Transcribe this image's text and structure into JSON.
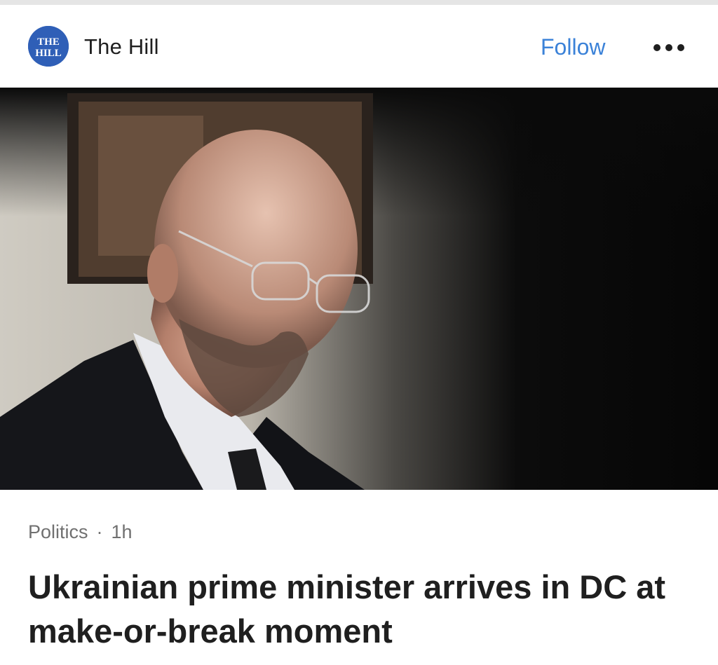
{
  "header": {
    "logo_text": "THE HILL",
    "publisher": "The Hill",
    "follow_label": "Follow",
    "more_icon": "more-horizontal-icon"
  },
  "hero": {
    "icon": "photo"
  },
  "article": {
    "section": "Politics",
    "separator": "·",
    "age": "1h",
    "headline": "Ukrainian prime minister arrives in DC at make-or-break moment"
  },
  "colors": {
    "accent": "#3b82d8",
    "logo_blue": "#2f5fb7",
    "text": "#1f1f1f",
    "meta": "#707070"
  }
}
